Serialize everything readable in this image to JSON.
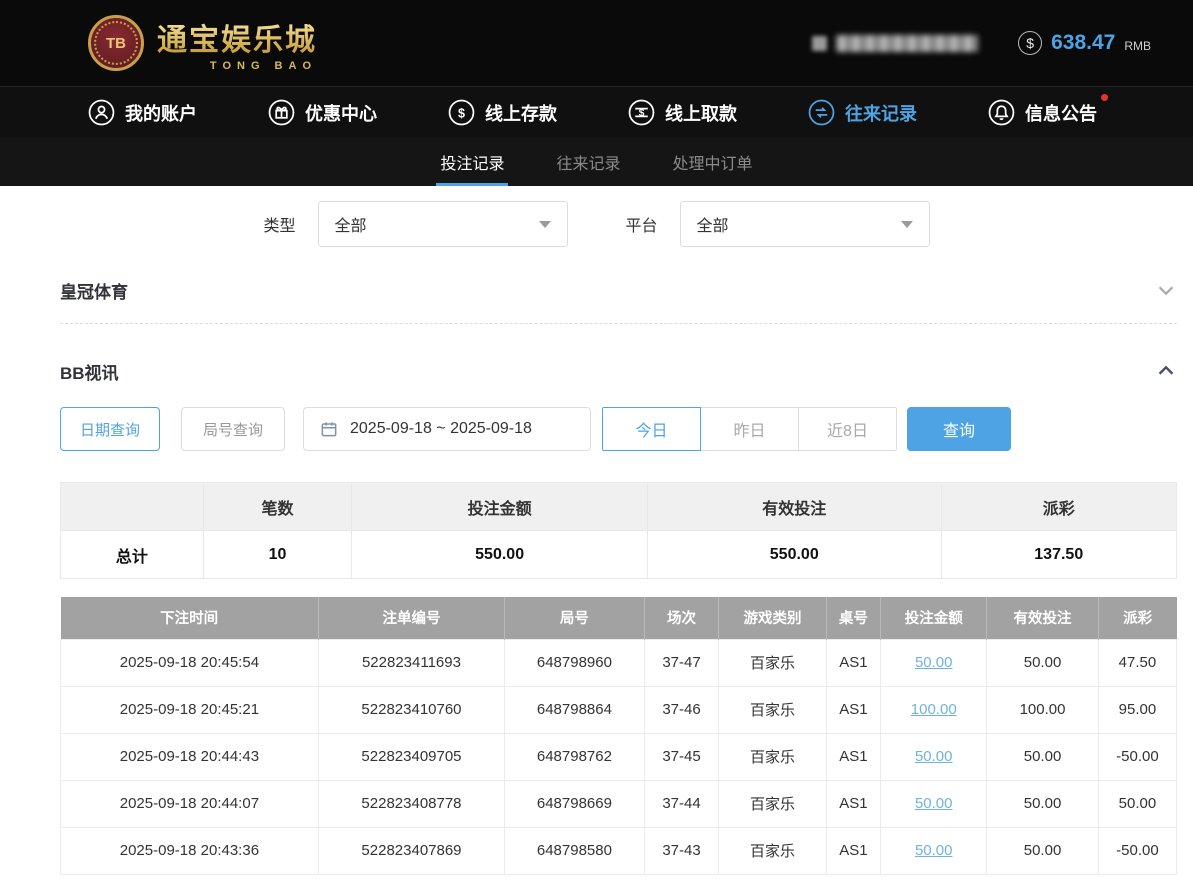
{
  "brand": {
    "badge": "TB",
    "name": "通宝娱乐城",
    "latin": "TONG BAO"
  },
  "account": {
    "dollar": "$",
    "balance": "638.47",
    "currency": "RMB"
  },
  "nav": {
    "items": [
      {
        "label": "我的账户",
        "icon": "user-icon"
      },
      {
        "label": "优惠中心",
        "icon": "gift-icon"
      },
      {
        "label": "线上存款",
        "icon": "deposit-icon"
      },
      {
        "label": "线上取款",
        "icon": "withdraw-icon"
      },
      {
        "label": "往来记录",
        "icon": "transfer-icon"
      },
      {
        "label": "信息公告",
        "icon": "bell-icon"
      }
    ]
  },
  "tabs": {
    "items": [
      {
        "label": "投注记录"
      },
      {
        "label": "往来记录"
      },
      {
        "label": "处理中订单"
      }
    ]
  },
  "filters": {
    "type": {
      "label": "类型",
      "value": "全部"
    },
    "platform": {
      "label": "平台",
      "value": "全部"
    }
  },
  "sections": {
    "sports": "皇冠体育",
    "bb": "BB视讯"
  },
  "query": {
    "date_tab": "日期查询",
    "round_tab": "局号查询",
    "range": "2025-09-18 ~ 2025-09-18",
    "today": "今日",
    "yesterday": "昨日",
    "last8": "近8日",
    "submit": "查询"
  },
  "summary": {
    "col_count": "笔数",
    "col_bet": "投注金额",
    "col_valid": "有效投注",
    "col_payout": "派彩",
    "row_label": "总计",
    "count": "10",
    "bet": "550.00",
    "valid": "550.00",
    "payout": "137.50"
  },
  "table": {
    "headers": {
      "time": "下注时间",
      "order": "注单编号",
      "round": "局号",
      "session": "场次",
      "game": "游戏类别",
      "tableno": "桌号",
      "bet": "投注金额",
      "valid": "有效投注",
      "payout": "派彩"
    },
    "rows": [
      {
        "time": "2025-09-18 20:45:54",
        "order": "522823411693",
        "round": "648798960",
        "session": "37-47",
        "game": "百家乐",
        "tableno": "AS1",
        "bet": "50.00",
        "valid": "50.00",
        "payout": "47.50"
      },
      {
        "time": "2025-09-18 20:45:21",
        "order": "522823410760",
        "round": "648798864",
        "session": "37-46",
        "game": "百家乐",
        "tableno": "AS1",
        "bet": "100.00",
        "valid": "100.00",
        "payout": "95.00"
      },
      {
        "time": "2025-09-18 20:44:43",
        "order": "522823409705",
        "round": "648798762",
        "session": "37-45",
        "game": "百家乐",
        "tableno": "AS1",
        "bet": "50.00",
        "valid": "50.00",
        "payout": "-50.00"
      },
      {
        "time": "2025-09-18 20:44:07",
        "order": "522823408778",
        "round": "648798669",
        "session": "37-44",
        "game": "百家乐",
        "tableno": "AS1",
        "bet": "50.00",
        "valid": "50.00",
        "payout": "50.00"
      },
      {
        "time": "2025-09-18 20:43:36",
        "order": "522823407869",
        "round": "648798580",
        "session": "37-43",
        "game": "百家乐",
        "tableno": "AS1",
        "bet": "50.00",
        "valid": "50.00",
        "payout": "-50.00"
      }
    ]
  },
  "colors": {
    "accent": "#4da3e4",
    "gold": "#d9b85c",
    "negative": "#e45b4f"
  }
}
